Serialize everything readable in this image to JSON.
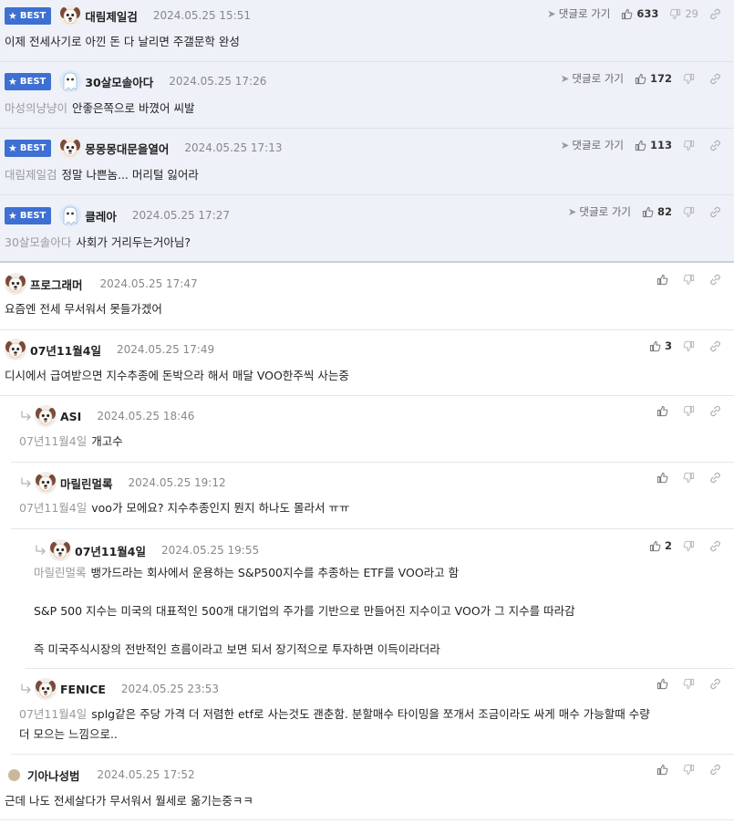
{
  "reply_label": "댓글로 가기",
  "best_label": "BEST",
  "icons": {
    "like": "thumbs-up-icon",
    "dislike": "thumbs-down-icon",
    "share": "share-icon",
    "reply_arrow": "reply-arrow-icon",
    "go": "paper-plane-icon"
  },
  "colors": {
    "best_bg": "#eef1f8",
    "badge": "#3e6fd2",
    "mention": "#9a9a9a"
  },
  "best": [
    {
      "nick": "대림제일검",
      "date": "2024.05.25 15:51",
      "mention": "",
      "text": "이제 전세사기로 아낀 돈 다 날리면 주갤문학 완성",
      "likes": "633",
      "dislikes": "29"
    },
    {
      "nick": "30살모솔아다",
      "date": "2024.05.25 17:26",
      "mention": "마성의냥냥이",
      "text": "안좋은쪽으로 바꼈어 씨발",
      "likes": "172",
      "dislikes": ""
    },
    {
      "nick": "몽몽몽대문을열어",
      "date": "2024.05.25 17:13",
      "mention": "대림제일검",
      "text": "정말 나쁜놈... 머리털 잃어라",
      "likes": "113",
      "dislikes": ""
    },
    {
      "nick": "클레아",
      "date": "2024.05.25 17:27",
      "mention": "30살모솔아다",
      "text": "사회가 거리두는거아님?",
      "likes": "82",
      "dislikes": ""
    }
  ],
  "comments": [
    {
      "nick": "프로그래머",
      "date": "2024.05.25 17:47",
      "mention": "",
      "text": "요즘엔 전세 무서워서 못들가겠어",
      "likes": ""
    },
    {
      "nick": "07년11월4일",
      "date": "2024.05.25 17:49",
      "mention": "",
      "text": "디시에서 급여받으면 지수추종에 돈박으라 해서 매달 VOO한주씩 사는중",
      "likes": "3"
    },
    {
      "nick": "ASI",
      "date": "2024.05.25 18:46",
      "mention": "07년11월4일",
      "text": "개고수",
      "likes": ""
    },
    {
      "nick": "마릴린멀록",
      "date": "2024.05.25 19:12",
      "mention": "07년11월4일",
      "text": "voo가 모에요? 지수추종인지 뭔지 하나도 몰라서 ㅠㅠ",
      "likes": ""
    },
    {
      "nick": "07년11월4일",
      "date": "2024.05.25 19:55",
      "mention": "마릴린멀록",
      "text": "뱅가드라는 회사에서 운용하는 S&P500지수를 추종하는 ETF를 VOO라고 함",
      "text2": "S&P 500 지수는 미국의 대표적인 500개 대기업의 주가를 기반으로 만들어진 지수이고 VOO가 그 지수를 따라감",
      "text3": "즉 미국주식시장의 전반적인 흐름이라고 보면 되서 장기적으로 투자하면 이득이라더라",
      "likes": "2"
    },
    {
      "nick": "FENICE",
      "date": "2024.05.25 23:53",
      "mention": "07년11월4일",
      "text": "splg같은 주당 가격 더 저렴한 etf로 사는것도 괜춘함. 분할매수 타이밍을 쪼개서 조금이라도 싸게 매수 가능할때 수량",
      "text2": "더 모으는 느낌으로..",
      "likes": ""
    },
    {
      "nick": "기아나성범",
      "date": "2024.05.25 17:52",
      "mention": "",
      "text": "근데 나도 전세살다가 무서워서 월세로 옮기는중ㅋㅋ",
      "likes": ""
    }
  ]
}
